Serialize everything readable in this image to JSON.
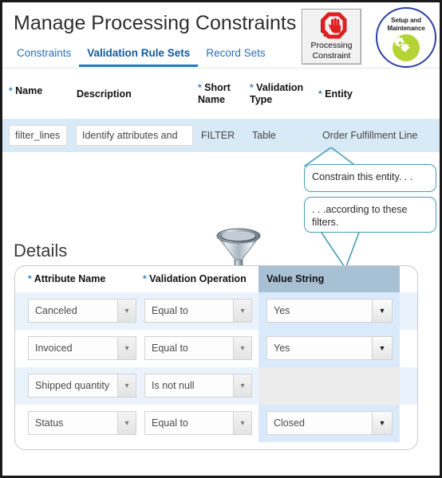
{
  "header": {
    "title": "Manage Processing Constraints",
    "tabs": [
      {
        "label": "Constraints",
        "active": false
      },
      {
        "label": "Validation Rule Sets",
        "active": true
      },
      {
        "label": "Record Sets",
        "active": false
      }
    ],
    "badges": {
      "processing_constraint": {
        "line1": "Processing",
        "line2": "Constraint",
        "icon": "stop-hand-icon",
        "color": "#e02020"
      },
      "setup_and_maintenance": {
        "line1": "Setup and",
        "line2": "Maintenance",
        "icon": "gears-icon",
        "ring_color": "#2b3fa0",
        "disc_color": "#b5d334"
      }
    }
  },
  "master_table": {
    "columns": [
      {
        "label": "Name",
        "required": true
      },
      {
        "label": "Description",
        "required": false
      },
      {
        "label": "Short Name",
        "required": true
      },
      {
        "label": "Validation Type",
        "required": true
      },
      {
        "label": "Entity",
        "required": true
      }
    ],
    "row": {
      "name": "filter_lines",
      "description": "Identify attributes and",
      "short_name": "FILTER",
      "validation_type": "Table",
      "entity": "Order Fulfillment Line"
    },
    "selected_row_color": "#d9eaf7"
  },
  "callouts": [
    {
      "text": "Constrain this entity. . ."
    },
    {
      "text": ". . .according to these filters."
    }
  ],
  "details": {
    "title": "Details",
    "funnel_icon": "funnel-icon",
    "columns": [
      {
        "label": "Attribute Name",
        "required": true
      },
      {
        "label": "Validation Operation",
        "required": true
      },
      {
        "label": "Value String",
        "required": false,
        "highlighted": true
      }
    ],
    "rows": [
      {
        "attribute_name": "Canceled",
        "validation_operation": "Equal to",
        "value_string": "Yes",
        "value_enabled": true
      },
      {
        "attribute_name": "Invoiced",
        "validation_operation": "Equal to",
        "value_string": "Yes",
        "value_enabled": true
      },
      {
        "attribute_name": "Shipped quantity",
        "validation_operation": "Is not null",
        "value_string": "",
        "value_enabled": false
      },
      {
        "attribute_name": "Status",
        "validation_operation": "Equal to",
        "value_string": "Closed",
        "value_enabled": true
      }
    ],
    "highlight_header_color": "#a8c0d4",
    "value_band_color": "#dbeafb"
  }
}
